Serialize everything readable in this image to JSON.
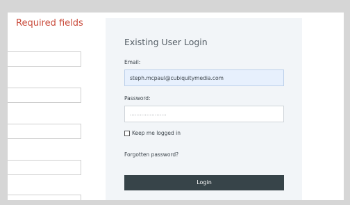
{
  "registration": {
    "required_label": "Required fields"
  },
  "login": {
    "title": "Existing User Login",
    "email_label": "Email:",
    "email_value": "steph.mcpaul@cubiquitymedia.com",
    "password_label": "Password:",
    "password_value": "......................",
    "remember_label": "Keep me logged in",
    "forgot_label": "Forgotten password?",
    "button_label": "Login"
  },
  "colors": {
    "required_text": "#c94a3a",
    "panel_bg": "#f2f5f8",
    "button_bg": "#374449",
    "email_autofill_bg": "#e7f0fd"
  }
}
